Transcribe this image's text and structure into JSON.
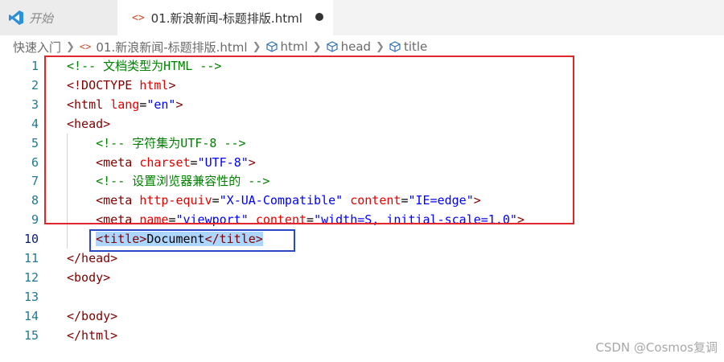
{
  "tabs": [
    {
      "label": "开始"
    },
    {
      "label": "01.新浪新闻-标题排版.html",
      "icon": "<>",
      "modified": true
    }
  ],
  "breadcrumb": {
    "root": "快速入门",
    "file_icon": "<>",
    "file": "01.新浪新闻-标题排版.html",
    "items": [
      "html",
      "head",
      "title"
    ]
  },
  "editor": {
    "active_line": 10,
    "lines": [
      {
        "n": "1",
        "tokens": [
          [
            "c",
            "<!-- 文档类型为HTML -->"
          ]
        ]
      },
      {
        "n": "2",
        "tokens": [
          [
            "t",
            "<!DOCTYPE "
          ],
          [
            "a",
            "html"
          ],
          [
            "t",
            ">"
          ]
        ]
      },
      {
        "n": "3",
        "tokens": [
          [
            "t",
            "<html "
          ],
          [
            "a",
            "lang"
          ],
          [
            "p",
            "="
          ],
          [
            "s",
            "\"en\""
          ],
          [
            "t",
            ">"
          ]
        ]
      },
      {
        "n": "4",
        "tokens": [
          [
            "t",
            "<head>"
          ]
        ]
      },
      {
        "n": "5",
        "indent": true,
        "tokens": [
          [
            "c",
            "    <!-- 字符集为UTF-8 -->"
          ]
        ]
      },
      {
        "n": "6",
        "indent": true,
        "tokens": [
          [
            "t",
            "    <meta "
          ],
          [
            "a",
            "charset"
          ],
          [
            "p",
            "="
          ],
          [
            "s",
            "\"UTF-8\""
          ],
          [
            "t",
            ">"
          ]
        ]
      },
      {
        "n": "7",
        "indent": true,
        "tokens": [
          [
            "c",
            "    <!-- 设置浏览器兼容性的 -->"
          ]
        ]
      },
      {
        "n": "8",
        "indent": true,
        "tokens": [
          [
            "t",
            "    <meta "
          ],
          [
            "a",
            "http-equiv"
          ],
          [
            "p",
            "="
          ],
          [
            "s",
            "\"X-UA-Compatible\""
          ],
          [
            "p",
            " "
          ],
          [
            "a",
            "content"
          ],
          [
            "p",
            "="
          ],
          [
            "s",
            "\"IE=edge\""
          ],
          [
            "t",
            ">"
          ]
        ]
      },
      {
        "n": "9",
        "indent": true,
        "tokens": [
          [
            "t",
            "    <meta "
          ],
          [
            "a",
            "name"
          ],
          [
            "p",
            "="
          ],
          [
            "s",
            "\"viewport\""
          ],
          [
            "p",
            " "
          ],
          [
            "a",
            "content"
          ],
          [
            "p",
            "="
          ],
          [
            "s",
            "\"width=S, initial-scale=1.0\""
          ],
          [
            "t",
            ">"
          ]
        ]
      },
      {
        "n": "10",
        "indent": true,
        "tokens": [
          [
            "p",
            "    "
          ],
          [
            "t sel",
            "<title>"
          ],
          [
            "p sel",
            "Document"
          ],
          [
            "t sel",
            "</title>"
          ]
        ]
      },
      {
        "n": "11",
        "tokens": [
          [
            "t",
            "</head>"
          ]
        ]
      },
      {
        "n": "12",
        "tokens": [
          [
            "t",
            "<body>"
          ]
        ]
      },
      {
        "n": "13",
        "tokens": []
      },
      {
        "n": "14",
        "tokens": [
          [
            "t",
            "</body>"
          ]
        ]
      },
      {
        "n": "15",
        "tokens": [
          [
            "t",
            "</html>"
          ]
        ]
      }
    ]
  },
  "watermark": "CSDN @Cosmos复调"
}
